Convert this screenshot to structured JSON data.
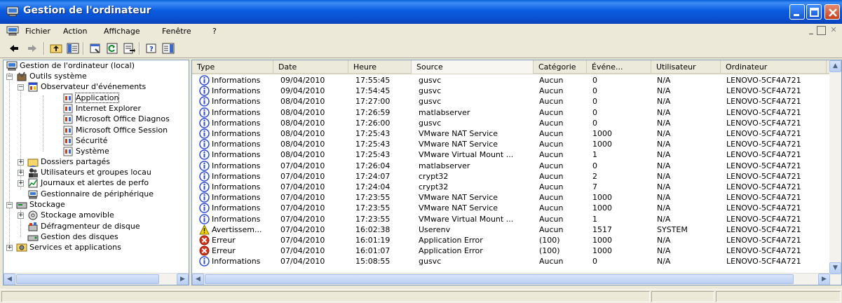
{
  "window": {
    "title": "Gestion de l'ordinateur"
  },
  "menu": {
    "items": [
      "Fichier",
      "Action",
      "Affichage",
      "Fenêtre",
      "?"
    ]
  },
  "toolbar": {
    "buttons": [
      "back-arrow-icon",
      "forward-arrow-icon",
      "up-folder-icon",
      "show-hide-tree-icon",
      "properties-icon",
      "refresh-icon",
      "export-list-icon",
      "help-icon",
      "show-hide-action-pane-icon"
    ]
  },
  "tree": {
    "root": "Gestion de l'ordinateur (local)",
    "system_tools": "Outils système",
    "event_viewer": "Observateur d'événements",
    "logs": [
      "Application",
      "Internet Explorer",
      "Microsoft Office Diagnos",
      "Microsoft Office Session",
      "Sécurité",
      "Système"
    ],
    "shared_folders": "Dossiers partagés",
    "local_users": "Utilisateurs et groupes locau",
    "perf_logs": "Journaux et alertes de perfo",
    "device_manager": "Gestionnaire de périphérique",
    "storage": "Stockage",
    "removable": "Stockage amovible",
    "defrag": "Défragmenteur de disque",
    "disk_mgmt": "Gestion des disques",
    "services": "Services et applications"
  },
  "table": {
    "columns": [
      "Type",
      "Date",
      "Heure",
      "Source",
      "Catégorie",
      "Événe...",
      "Utilisateur",
      "Ordinateur"
    ],
    "rows": [
      {
        "type": "Informations",
        "icon": "info",
        "date": "09/04/2010",
        "time": "17:55:45",
        "source": "gusvc",
        "category": "Aucun",
        "event": "0",
        "user": "N/A",
        "computer": "LENOVO-5CF4A721"
      },
      {
        "type": "Informations",
        "icon": "info",
        "date": "09/04/2010",
        "time": "17:54:45",
        "source": "gusvc",
        "category": "Aucun",
        "event": "0",
        "user": "N/A",
        "computer": "LENOVO-5CF4A721"
      },
      {
        "type": "Informations",
        "icon": "info",
        "date": "08/04/2010",
        "time": "17:27:00",
        "source": "gusvc",
        "category": "Aucun",
        "event": "0",
        "user": "N/A",
        "computer": "LENOVO-5CF4A721"
      },
      {
        "type": "Informations",
        "icon": "info",
        "date": "08/04/2010",
        "time": "17:26:59",
        "source": "matlabserver",
        "category": "Aucun",
        "event": "0",
        "user": "N/A",
        "computer": "LENOVO-5CF4A721"
      },
      {
        "type": "Informations",
        "icon": "info",
        "date": "08/04/2010",
        "time": "17:26:00",
        "source": "gusvc",
        "category": "Aucun",
        "event": "0",
        "user": "N/A",
        "computer": "LENOVO-5CF4A721"
      },
      {
        "type": "Informations",
        "icon": "info",
        "date": "08/04/2010",
        "time": "17:25:43",
        "source": "VMware NAT Service",
        "category": "Aucun",
        "event": "1000",
        "user": "N/A",
        "computer": "LENOVO-5CF4A721"
      },
      {
        "type": "Informations",
        "icon": "info",
        "date": "08/04/2010",
        "time": "17:25:43",
        "source": "VMware NAT Service",
        "category": "Aucun",
        "event": "1000",
        "user": "N/A",
        "computer": "LENOVO-5CF4A721"
      },
      {
        "type": "Informations",
        "icon": "info",
        "date": "08/04/2010",
        "time": "17:25:43",
        "source": "VMware Virtual Mount ...",
        "category": "Aucun",
        "event": "1",
        "user": "N/A",
        "computer": "LENOVO-5CF4A721"
      },
      {
        "type": "Informations",
        "icon": "info",
        "date": "07/04/2010",
        "time": "17:26:04",
        "source": "matlabserver",
        "category": "Aucun",
        "event": "0",
        "user": "N/A",
        "computer": "LENOVO-5CF4A721"
      },
      {
        "type": "Informations",
        "icon": "info",
        "date": "07/04/2010",
        "time": "17:24:07",
        "source": "crypt32",
        "category": "Aucun",
        "event": "2",
        "user": "N/A",
        "computer": "LENOVO-5CF4A721"
      },
      {
        "type": "Informations",
        "icon": "info",
        "date": "07/04/2010",
        "time": "17:24:04",
        "source": "crypt32",
        "category": "Aucun",
        "event": "7",
        "user": "N/A",
        "computer": "LENOVO-5CF4A721"
      },
      {
        "type": "Informations",
        "icon": "info",
        "date": "07/04/2010",
        "time": "17:23:55",
        "source": "VMware NAT Service",
        "category": "Aucun",
        "event": "1000",
        "user": "N/A",
        "computer": "LENOVO-5CF4A721"
      },
      {
        "type": "Informations",
        "icon": "info",
        "date": "07/04/2010",
        "time": "17:23:55",
        "source": "VMware NAT Service",
        "category": "Aucun",
        "event": "1000",
        "user": "N/A",
        "computer": "LENOVO-5CF4A721"
      },
      {
        "type": "Informations",
        "icon": "info",
        "date": "07/04/2010",
        "time": "17:23:55",
        "source": "VMware Virtual Mount ...",
        "category": "Aucun",
        "event": "1",
        "user": "N/A",
        "computer": "LENOVO-5CF4A721"
      },
      {
        "type": "Avertissem...",
        "icon": "warning",
        "date": "07/04/2010",
        "time": "16:02:38",
        "source": "Userenv",
        "category": "Aucun",
        "event": "1517",
        "user": "SYSTEM",
        "computer": "LENOVO-5CF4A721"
      },
      {
        "type": "Erreur",
        "icon": "error",
        "date": "07/04/2010",
        "time": "16:01:19",
        "source": "Application Error",
        "category": "(100)",
        "event": "1000",
        "user": "N/A",
        "computer": "LENOVO-5CF4A721"
      },
      {
        "type": "Erreur",
        "icon": "error",
        "date": "07/04/2010",
        "time": "16:01:07",
        "source": "Application Error",
        "category": "(100)",
        "event": "1000",
        "user": "N/A",
        "computer": "LENOVO-5CF4A721"
      },
      {
        "type": "Informations",
        "icon": "info",
        "date": "07/04/2010",
        "time": "15:08:55",
        "source": "gusvc",
        "category": "Aucun",
        "event": "0",
        "user": "N/A",
        "computer": "LENOVO-5CF4A721"
      }
    ]
  },
  "colors": {
    "titlebar": "#0a5be0",
    "info": "#2a4bd0",
    "warning": "#f5d400",
    "error": "#d4331c"
  }
}
